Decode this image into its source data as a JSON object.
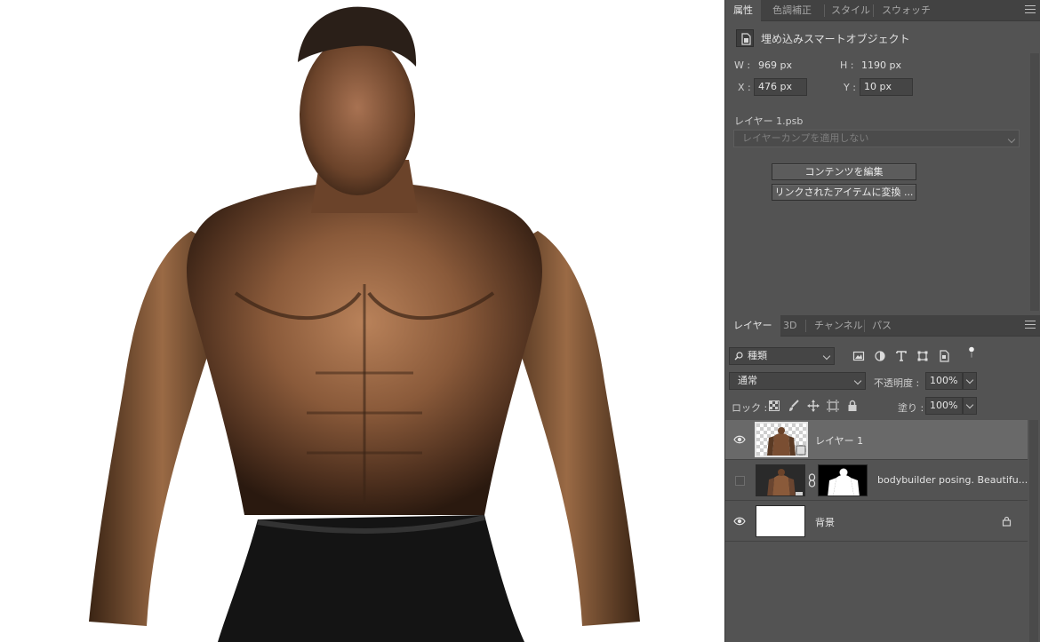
{
  "properties_panel": {
    "tabs": [
      "属性",
      "色調補正",
      "スタイル",
      "スウォッチ"
    ],
    "active_tab": "属性",
    "object_type": "埋め込みスマートオブジェクト",
    "w_label": "W :",
    "w_value": "969 px",
    "h_label": "H :",
    "h_value": "1190 px",
    "x_label": "X :",
    "x_value": "476 px",
    "y_label": "Y :",
    "y_value": "10 px",
    "file_name": "レイヤー 1.psb",
    "layer_comp": "レイヤーカンプを適用しない",
    "edit_contents_button": "コンテンツを編集",
    "convert_linked_button": "リンクされたアイテムに変換 ..."
  },
  "layers_panel": {
    "tabs": [
      "レイヤー",
      "3D",
      "チャンネル",
      "パス"
    ],
    "active_tab": "レイヤー",
    "filter_kind": "種類",
    "blend_mode": "通常",
    "opacity_label": "不透明度 :",
    "opacity_value": "100%",
    "lock_label": "ロック :",
    "fill_label": "塗り :",
    "fill_value": "100%",
    "layers": [
      {
        "name": "レイヤー 1",
        "visible": true,
        "selected": true,
        "type": "smart-object"
      },
      {
        "name": "bodybuilder posing. Beautifu...",
        "visible": false,
        "selected": false,
        "type": "masked-image"
      },
      {
        "name": "背景",
        "visible": true,
        "selected": false,
        "type": "background",
        "locked": true
      }
    ]
  },
  "colors": {
    "panel_bg": "#535353",
    "tab_bar_bg": "#424242",
    "selected_layer": "#696969",
    "canvas_bg": "#ffffff"
  }
}
